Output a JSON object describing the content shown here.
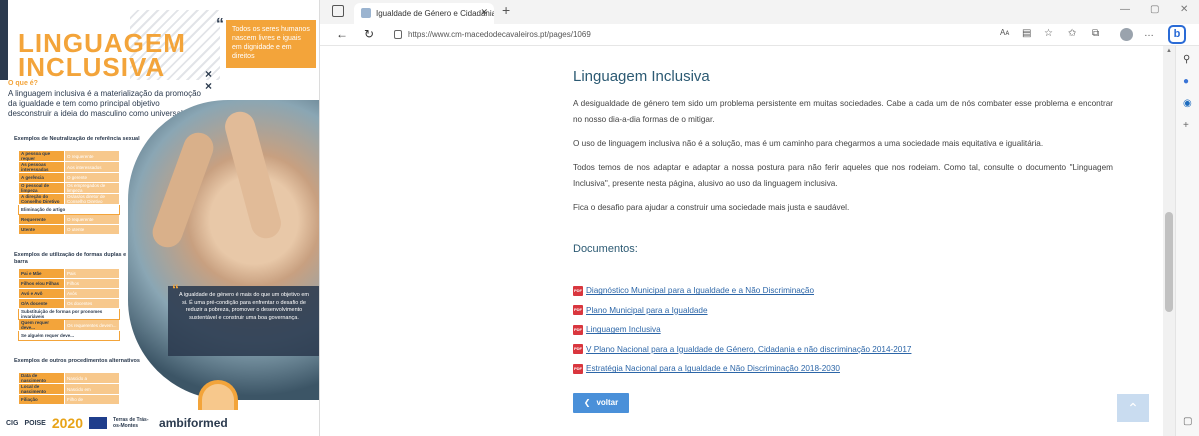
{
  "poster": {
    "title_line1": "LINGUAGEM",
    "title_line2": "INCLUSIVA",
    "top_quote": "Todos os seres humanos nascem livres e iguais em dignidade e em direitos",
    "what_heading": "O que é?",
    "what_text": "A linguagem inclusiva é a materialização da promoção da igualdade e tem como principal objetivo desconstruir a ideia do masculino como universal.",
    "section1_title": "Exemplos de Neutralização de referência sexual",
    "section1_rows": [
      {
        "a": "A pessoa que requer",
        "b": "O requerente"
      },
      {
        "a": "As pessoas interessadas",
        "b": "Aos interessados"
      },
      {
        "a": "A gerência",
        "b": "O gerente"
      },
      {
        "a": "O pessoal de limpeza",
        "b": "Os empregados de limpeza"
      },
      {
        "a": "A direção do Conselho Diretivo",
        "b": "Os/as/os diretor de Conselho Diretivo"
      },
      {
        "a": "Eliminação do artigo",
        "b": ""
      },
      {
        "a": "Requerente",
        "b": "O requerente"
      },
      {
        "a": "Utente",
        "b": "O utente"
      }
    ],
    "section2_title": "Exemplos de utilização de formas duplas e com barra",
    "section2_rows": [
      {
        "a": "Pai e Mãe",
        "b": "Pais"
      },
      {
        "a": "Filhos e/ou Filhas",
        "b": "Filhos"
      },
      {
        "a": "Avó e Avô",
        "b": "Avós"
      },
      {
        "a": "O/A docente",
        "b": "Os docentes"
      },
      {
        "a": "Substituição de formas por pronomes invariáveis",
        "b": ""
      },
      {
        "a": "Quem requer deve...",
        "b": "Os requerentes devem..."
      },
      {
        "a": "Se alguém requer deve...",
        "b": ""
      }
    ],
    "section3_title": "Exemplos de outros procedimentos alternativos",
    "section3_rows": [
      {
        "a": "Data de nascimento",
        "b": "Nascido a"
      },
      {
        "a": "Local de nascimento",
        "b": "Nascido em"
      },
      {
        "a": "Filiação",
        "b": "Filho de"
      }
    ],
    "quote": "A igualdade de género é mais do que um objetivo em si. É uma pré-condição para enfrentar o desafio de reduzir a pobreza, promover o desenvolvimento sustentável e construir uma boa governança.",
    "logos": [
      "CIG",
      "POISE",
      "2020",
      "Terras de Trás-os-Montes",
      "ambiformed"
    ]
  },
  "browser": {
    "tab_title": "Igualdade de Género e Cidadania",
    "url": "https://www.cm-macedodecavaleiros.pt/pages/1069",
    "read_aloud": "Aᴀ",
    "bing_label": "b"
  },
  "page": {
    "title": "Linguagem Inclusiva",
    "paragraphs": [
      "A desigualdade de género tem sido um problema persistente em muitas sociedades. Cabe a cada um de nós combater esse problema e encontrar no nosso dia-a-dia formas de o mitigar.",
      "O uso de linguagem inclusiva não é a solução, mas é um caminho para chegarmos a uma sociedade mais equitativa e igualitária.",
      "Todos temos de nos adaptar e adaptar a nossa postura para não ferir aqueles que nos rodeiam. Como tal, consulte o documento \"Linguagem Inclusiva\", presente nesta página, alusivo ao uso da linguagem inclusiva.",
      "Fica o desafio para ajudar a construir uma sociedade mais justa e saudável."
    ],
    "documents_heading": "Documentos:",
    "documents": [
      "Diagnóstico Municipal para a Igualdade e a Não Discriminação",
      "Plano Municipal para a Igualdade",
      "Linguagem Inclusiva",
      "V Plano Nacional para a Igualdade de Género, Cidadania e não discriminação 2014-2017",
      "Estratégia Nacional para a Igualdade e Não Discriminação 2018-2030"
    ],
    "pdf_icon_text": "PDF",
    "back_label": "voltar"
  }
}
